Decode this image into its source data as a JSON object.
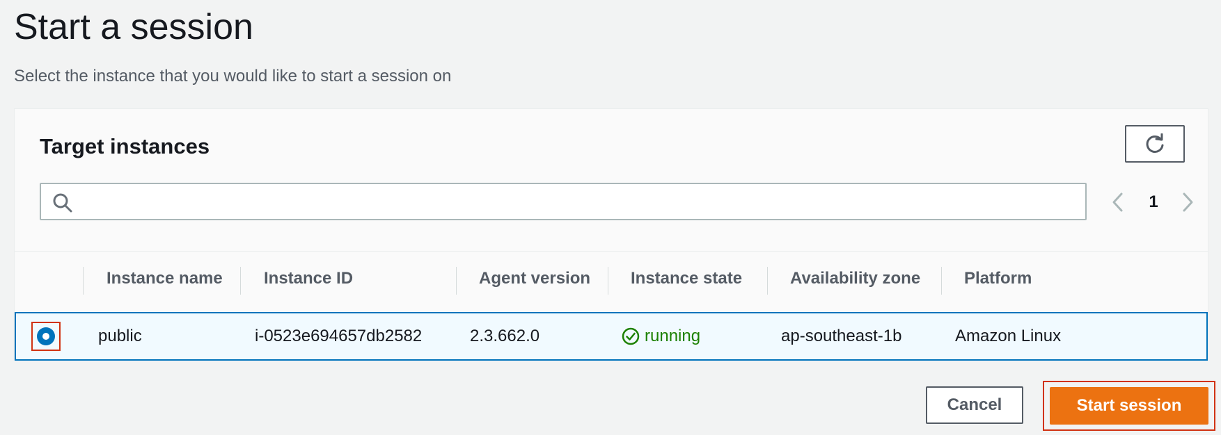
{
  "page": {
    "title": "Start a session",
    "description": "Select the instance that you would like to start a session on"
  },
  "panel": {
    "title": "Target instances",
    "refresh_icon": "refresh-icon",
    "search": {
      "value": "",
      "placeholder": "",
      "icon": "search-icon"
    },
    "pagination": {
      "current_page": "1"
    }
  },
  "table": {
    "columns": [
      "Instance name",
      "Instance ID",
      "Agent version",
      "Instance state",
      "Availability zone",
      "Platform"
    ],
    "rows": [
      {
        "selected": true,
        "instance_name": "public",
        "instance_id": "i-0523e694657db2582",
        "agent_version": "2.3.662.0",
        "instance_state": "running",
        "availability_zone": "ap-southeast-1b",
        "platform": "Amazon Linux"
      }
    ]
  },
  "actions": {
    "cancel_label": "Cancel",
    "start_label": "Start session"
  },
  "colors": {
    "accent": "#0073bb",
    "primary_button": "#ec7211",
    "running": "#1d8102",
    "highlight_border": "#d13212"
  }
}
